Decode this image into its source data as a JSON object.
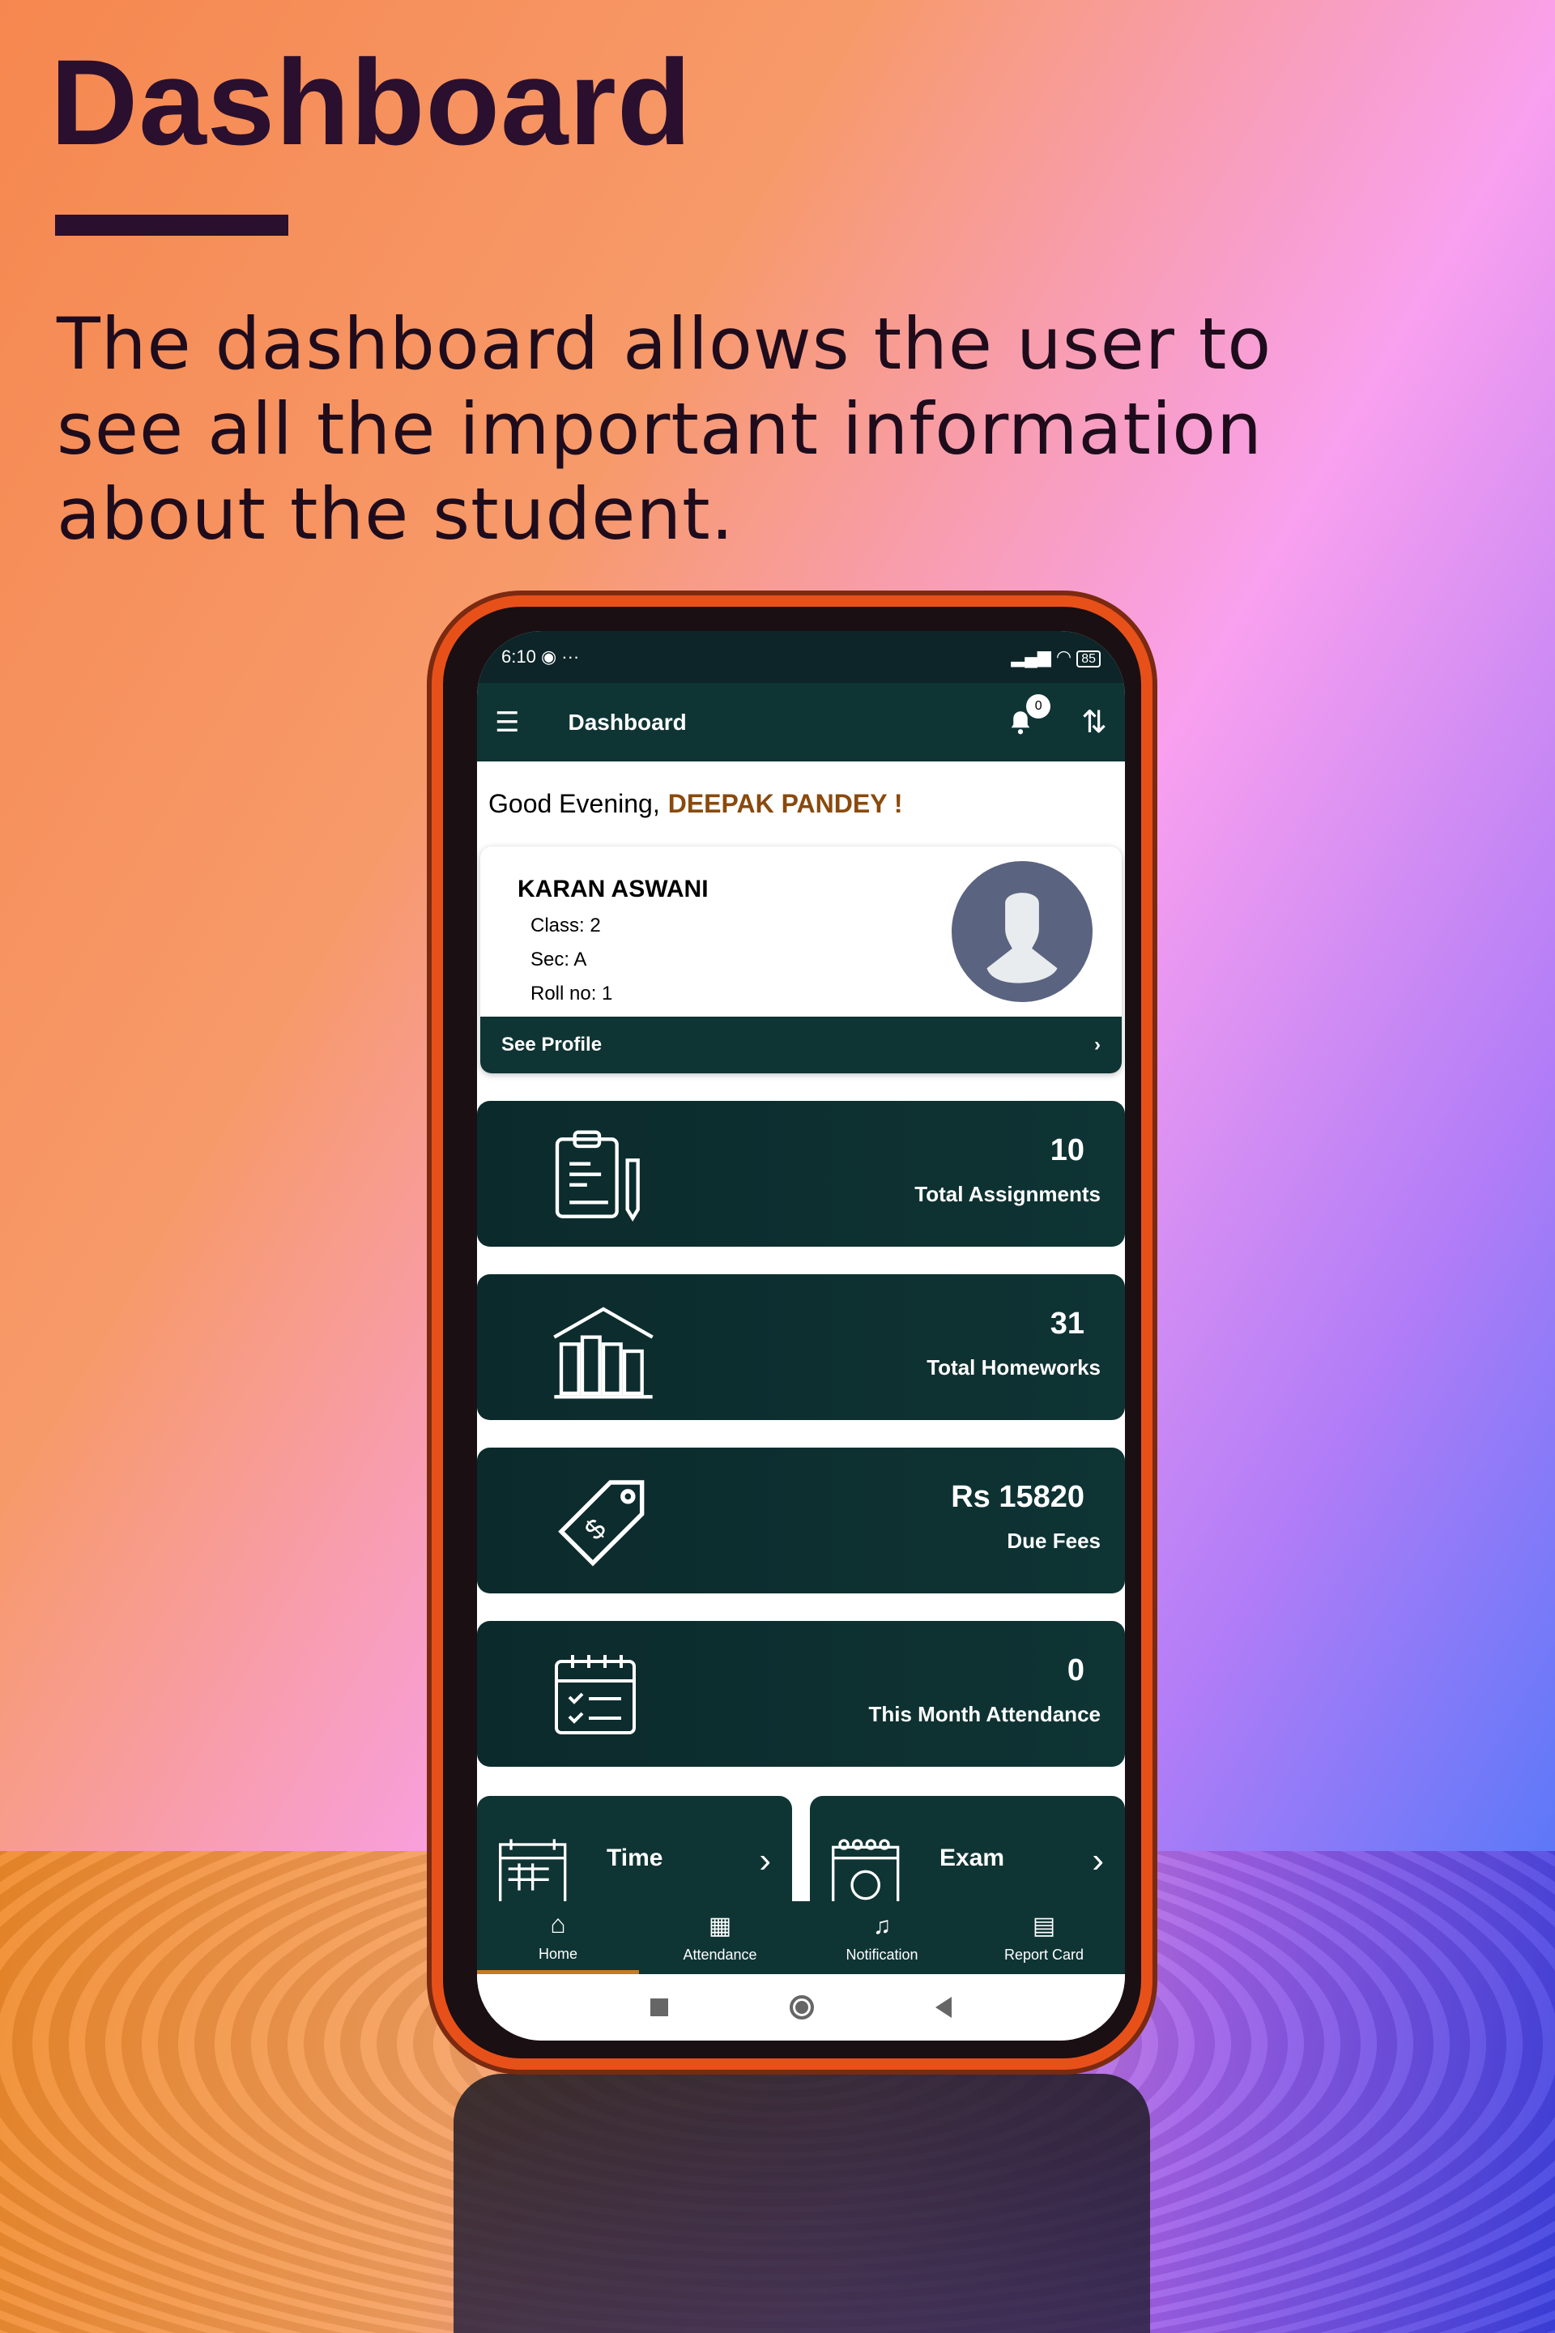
{
  "hero": {
    "title": "Dashboard",
    "description": "The dashboard allows the user to see all the important information about the student."
  },
  "status": {
    "time": "6:10",
    "more": "···",
    "battery": "85"
  },
  "appbar": {
    "title": "Dashboard",
    "notification_count": "0"
  },
  "greeting": {
    "prefix": "Good Evening,",
    "name": "DEEPAK  PANDEY !"
  },
  "profile": {
    "name": "KARAN ASWANI",
    "class": "Class: 2",
    "section": "Sec: A",
    "roll": "Roll no: 1",
    "see_profile": "See Profile"
  },
  "stats": [
    {
      "value": "10",
      "label": "Total Assignments",
      "icon": "clipboard-pencil-icon"
    },
    {
      "value": "31",
      "label": "Total Homeworks",
      "icon": "library-icon"
    },
    {
      "value": "Rs 15820",
      "label": "Due Fees",
      "icon": "price-tag-icon"
    },
    {
      "value": "0",
      "label": "This Month Attendance",
      "icon": "calendar-check-icon"
    }
  ],
  "tiles": [
    {
      "label": "Time",
      "icon": "timetable-icon"
    },
    {
      "label": "Exam",
      "icon": "exam-calendar-icon"
    }
  ],
  "nav": [
    {
      "label": "Home",
      "icon": "home-icon",
      "active": true
    },
    {
      "label": "Attendance",
      "icon": "attendance-icon"
    },
    {
      "label": "Notification",
      "icon": "bell-icon"
    },
    {
      "label": "Report Card",
      "icon": "report-card-icon"
    }
  ],
  "colors": {
    "primary": "#0f3434",
    "accent": "#8a4a0c",
    "title": "#2b0f2e"
  }
}
